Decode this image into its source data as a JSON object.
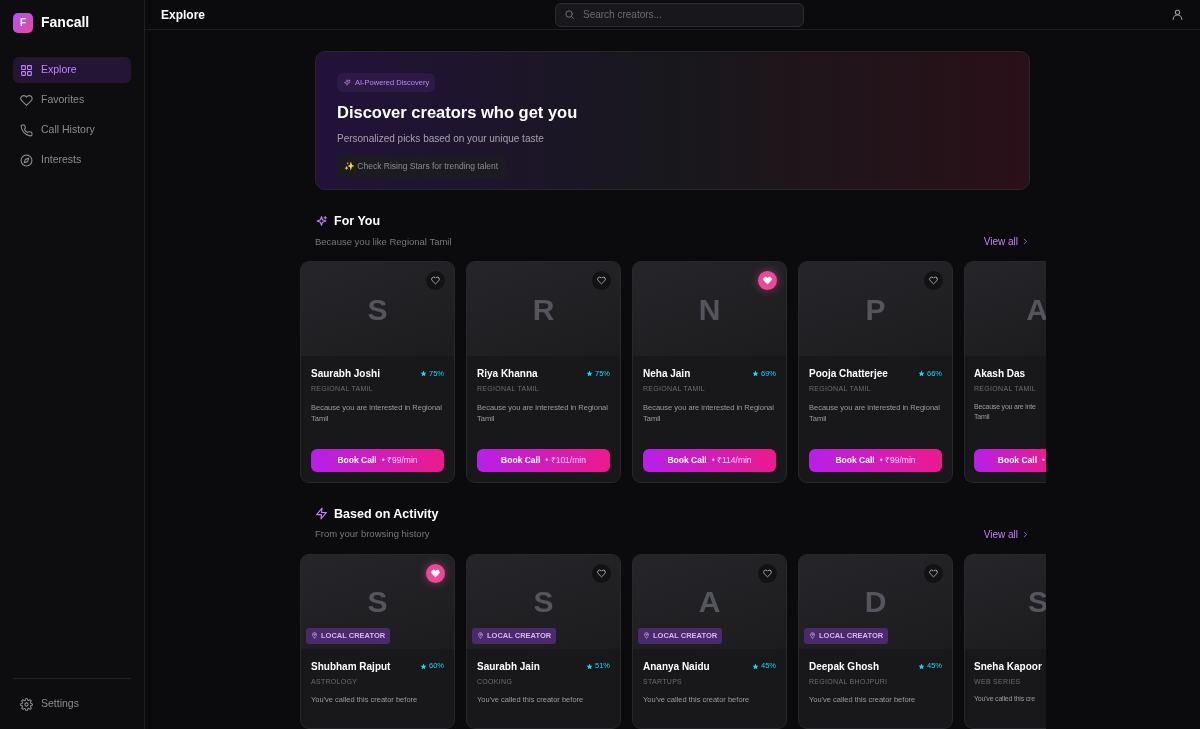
{
  "app": {
    "logo_letter": "F",
    "name": "Fancall"
  },
  "sidebar": {
    "items": [
      {
        "label": "Explore",
        "selected": true
      },
      {
        "label": "Favorites",
        "selected": false
      },
      {
        "label": "Call History",
        "selected": false
      },
      {
        "label": "Interests",
        "selected": false
      }
    ],
    "footer_items": [
      {
        "label": "Settings"
      }
    ]
  },
  "header": {
    "title": "Explore",
    "search": {
      "placeholder": "Search creators..."
    }
  },
  "hero": {
    "badge": "AI-Powered Discovery",
    "title": "Discover creators who get you",
    "subtitle": "Personalized picks based on your unique taste",
    "tip": "✨ Check Rising Stars for trending talent"
  },
  "sections": [
    {
      "title": "For You",
      "subtitle": "Because you like Regional Tamil",
      "link": "View all",
      "cards": [
        {
          "initial": "S",
          "favorite": false,
          "name": "Saurabh Joshi",
          "rating": "75%",
          "category": "REGIONAL TAMIL",
          "reason": "Because you are interested in Regional Tamil",
          "button": "Book Call",
          "price": "• ₹99/min"
        },
        {
          "initial": "R",
          "favorite": false,
          "name": "Riya Khanna",
          "rating": "75%",
          "category": "REGIONAL TAMIL",
          "reason": "Because you are interested in Regional Tamil",
          "button": "Book Call",
          "price": "• ₹101/min"
        },
        {
          "initial": "N",
          "favorite": true,
          "name": "Neha Jain",
          "rating": "69%",
          "category": "REGIONAL TAMIL",
          "reason": "Because you are interested in Regional Tamil",
          "button": "Book Call",
          "price": "• ₹114/min"
        },
        {
          "initial": "P",
          "favorite": false,
          "name": "Pooja Chatterjee",
          "rating": "66%",
          "category": "REGIONAL TAMIL",
          "reason": "Because you are interested in Regional Tamil",
          "button": "Book Call",
          "price": "• ₹99/min"
        },
        {
          "initial": "A",
          "name": "Akash Das",
          "category": "REGIONAL TAMIL",
          "reason": "Because you are inte\nTamil",
          "button": "Book Call",
          "price": "•"
        }
      ]
    },
    {
      "title": "Based on Activity",
      "subtitle": "From your browsing history",
      "link": "View all",
      "cards": [
        {
          "initial": "S",
          "favorite": true,
          "badge": "LOCAL CREATOR",
          "name": "Shubham Rajput",
          "rating": "60%",
          "category": "ASTROLOGY",
          "reason": "You've called this creator before"
        },
        {
          "initial": "S",
          "favorite": false,
          "badge": "LOCAL CREATOR",
          "name": "Saurabh Jain",
          "rating": "51%",
          "category": "COOKING",
          "reason": "You've called this creator before"
        },
        {
          "initial": "A",
          "favorite": false,
          "badge": "LOCAL CREATOR",
          "name": "Ananya Naidu",
          "rating": "45%",
          "category": "STARTUPS",
          "reason": "You've called this creator before"
        },
        {
          "initial": "D",
          "favorite": false,
          "badge": "LOCAL CREATOR",
          "name": "Deepak Ghosh",
          "rating": "45%",
          "category": "REGIONAL BHOJPURI",
          "reason": "You've called this creator before"
        },
        {
          "initial": "S",
          "name": "Sneha Kapoor",
          "category": "WEB SERIES",
          "reason": "You've called this cre"
        }
      ]
    }
  ]
}
